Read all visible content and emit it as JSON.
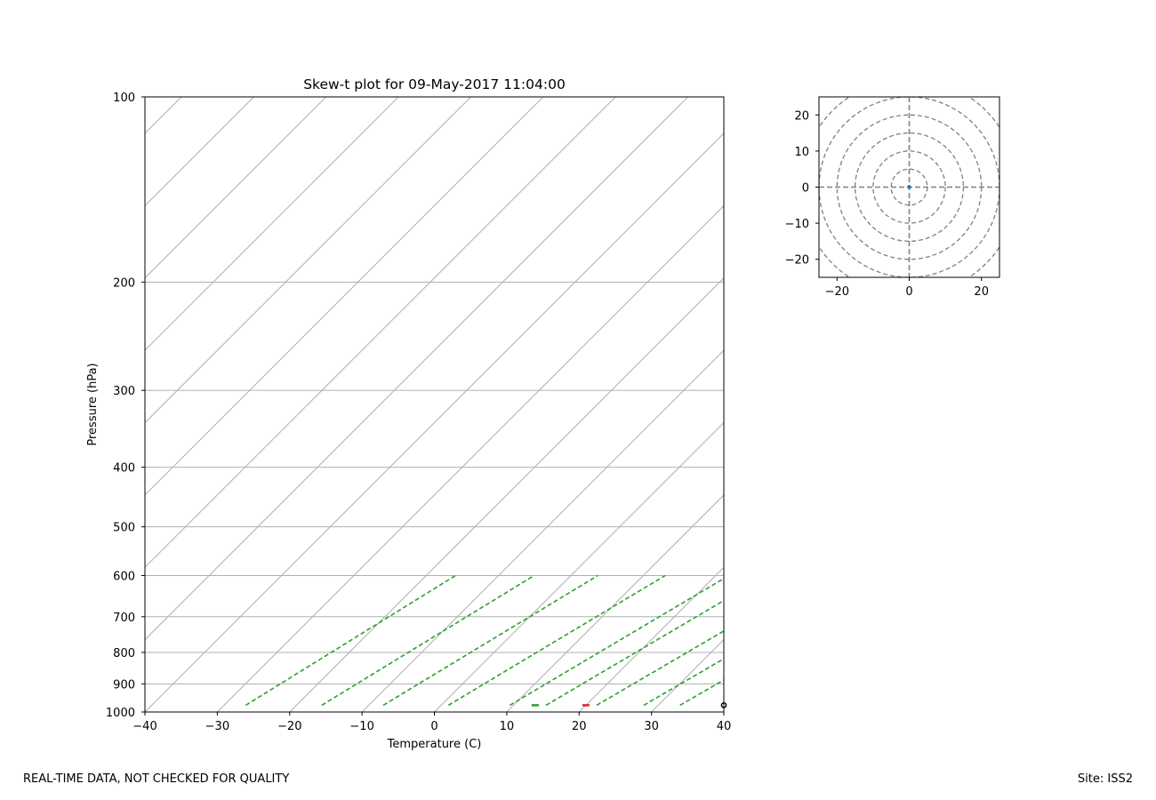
{
  "footer": {
    "left_text": "REAL-TIME DATA, NOT CHECKED FOR QUALITY",
    "right_text": "Site: ISS2"
  },
  "chart_data": [
    {
      "type": "skew-t",
      "title": "Skew-t plot for 09-May-2017 11:04:00",
      "xlabel": "Temperature (C)",
      "ylabel": "Pressure (hPa)",
      "xlim": [
        -40,
        40
      ],
      "ylim": [
        1000,
        100
      ],
      "y_scale": "log",
      "x_ticks": [
        -40,
        -30,
        -20,
        -10,
        0,
        10,
        20,
        30,
        40
      ],
      "x_tick_labels": [
        "−40",
        "−30",
        "−20",
        "−10",
        "0",
        "10",
        "20",
        "30",
        "40"
      ],
      "y_ticks": [
        1000,
        900,
        800,
        700,
        600,
        500,
        400,
        300,
        200,
        100
      ],
      "y_tick_labels": [
        "1000",
        "900",
        "800",
        "700",
        "600",
        "500",
        "400",
        "300",
        "200",
        "100"
      ],
      "grid": true,
      "isotherms": [
        -150,
        -140,
        -130,
        -120,
        -110,
        -100,
        -90,
        -80,
        -70,
        -60,
        -50,
        -40,
        -30,
        -20,
        -10,
        0,
        10,
        20,
        30,
        40
      ],
      "mixing_ratio_lines": {
        "color": "#2ca02c",
        "style": "dashed",
        "p_range": [
          600,
          975
        ],
        "surface_temperatures": [
          -27,
          -16.5,
          -8,
          1,
          9.5,
          14.5,
          21.5,
          28,
          33,
          40.5
        ]
      },
      "series": [
        {
          "name": "",
          "color": "#d62728",
          "points": [
            [
              20,
              975
            ]
          ]
        },
        {
          "name": "",
          "color": "#2ca02c",
          "points": [
            [
              13,
              975
            ]
          ]
        },
        {
          "name": "",
          "color": "#000000",
          "points": [
            [
              40,
              975
            ]
          ]
        }
      ]
    },
    {
      "type": "hodograph",
      "xlim": [
        -25,
        25
      ],
      "ylim": [
        -25,
        25
      ],
      "x_ticks": [
        -20,
        0,
        20
      ],
      "x_tick_labels": [
        "−20",
        "0",
        "20"
      ],
      "y_ticks": [
        -20,
        -10,
        0,
        10,
        20
      ],
      "y_tick_labels": [
        "−20",
        "−10",
        "0",
        "10",
        "20"
      ],
      "rings": [
        5,
        10,
        15,
        20,
        25,
        30
      ],
      "points": [
        [
          0,
          0
        ]
      ],
      "point_color": "#1f77b4"
    }
  ]
}
